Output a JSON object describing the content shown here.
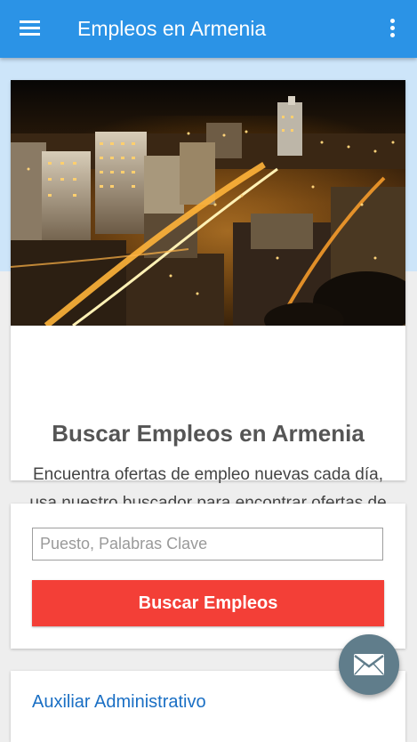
{
  "app_bar": {
    "title": "Empleos en Armenia",
    "menu_icon": "hamburger-menu-icon",
    "overflow_icon": "more-vertical-icon"
  },
  "hero": {
    "image": "night-city-photo",
    "heading": "Buscar Empleos en Armenia",
    "description": "Encuentra ofertas de empleo nuevas cada día, usa nuestro buscador para encontrar ofertas de trabajo locales."
  },
  "search": {
    "placeholder": "Puesto, Palabras Clave",
    "value": "",
    "button_label": "Buscar Empleos"
  },
  "results": {
    "items": [
      {
        "title": "Auxiliar Administrativo"
      }
    ]
  },
  "fab": {
    "icon": "envelope-icon"
  },
  "colors": {
    "app_bar": "#2b93e6",
    "header_band": "#cde5f9",
    "search_button": "#f33f37",
    "fab": "#607d8b",
    "link": "#1a6fc4"
  }
}
